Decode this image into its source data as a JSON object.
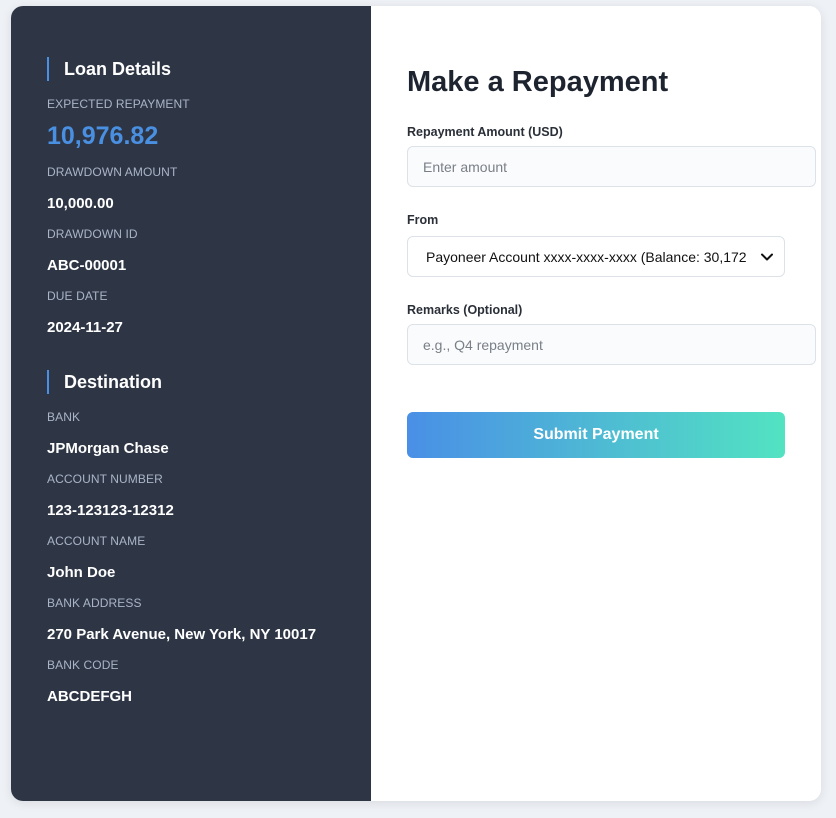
{
  "sidebar": {
    "loan_title": "Loan Details",
    "loan_items": [
      {
        "label": "EXPECTED REPAYMENT",
        "value": "10,976.82"
      },
      {
        "label": "DRAWDOWN AMOUNT",
        "value": "10,000.00"
      },
      {
        "label": "DRAWDOWN ID",
        "value": "ABC-00001"
      },
      {
        "label": "DUE DATE",
        "value": "2024-11-27"
      }
    ],
    "dest_title": "Destination",
    "dest_items": [
      {
        "label": "BANK",
        "value": "JPMorgan Chase"
      },
      {
        "label": "ACCOUNT NUMBER",
        "value": "123-123123-12312"
      },
      {
        "label": "ACCOUNT NAME",
        "value": "John Doe"
      },
      {
        "label": "BANK ADDRESS",
        "value": "270 Park Avenue, New York, NY 10017"
      },
      {
        "label": "BANK CODE",
        "value": "ABCDEFGH"
      }
    ]
  },
  "main": {
    "title": "Make a Repayment",
    "amount_label": "Repayment Amount (USD)",
    "amount_placeholder": "Enter amount",
    "from_label": "From",
    "from_selected": "Payoneer Account xxxx-xxxx-xxxx (Balance: 30,172",
    "remarks_label": "Remarks (Optional)",
    "remarks_placeholder": "e.g., Q4 repayment",
    "submit_label": "Submit Payment"
  },
  "colors": {
    "sidebar_bg": "#2e3646",
    "accent": "#4a90e2",
    "gradient_start": "#4a8fe6",
    "gradient_end": "#52e3c2"
  },
  "icons": {
    "select_arrow": "chevron-down-icon"
  }
}
